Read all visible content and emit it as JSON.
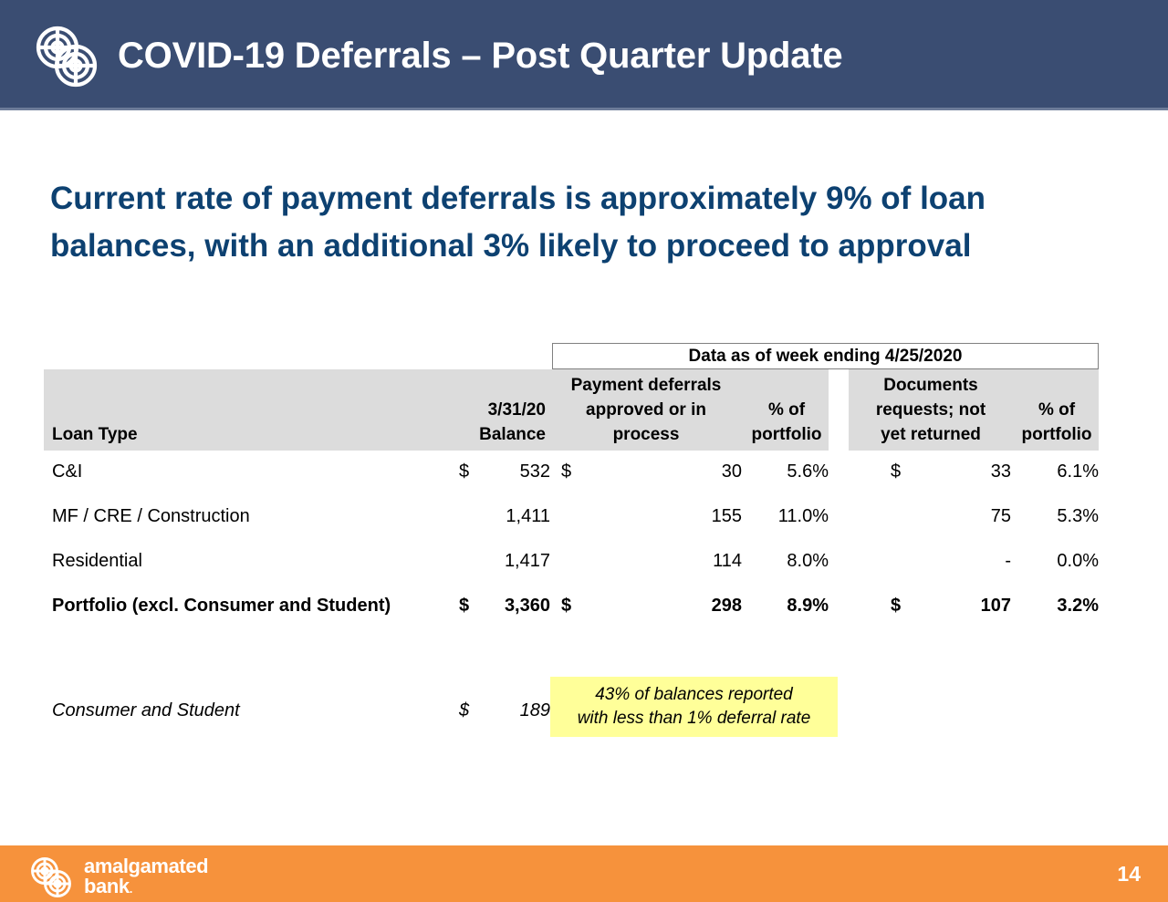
{
  "header": {
    "title": "COVID-19 Deferrals – Post Quarter Update",
    "logo_icon": "amalgamated-spiral-logo-icon",
    "bar_color": "#3a4d72"
  },
  "headline": {
    "line1": "Current rate of payment deferrals is approximately 9% of loan",
    "line2": "balances, with an additional 3% likely to proceed to approval",
    "color": "#0d4171"
  },
  "table": {
    "banner": "Data as of week ending 4/25/2020",
    "band_color": "#dcdcdc",
    "columns": {
      "loan_type": "Loan Type",
      "balance_l1": "3/31/20",
      "balance_l2": "Balance",
      "deferrals_l1": "Payment deferrals",
      "deferrals_l2": "approved or in",
      "deferrals_l3": "process",
      "pct1_l1": "% of",
      "pct1_l2": "portfolio",
      "docs_l1": "Documents",
      "docs_l2": "requests; not",
      "docs_l3": "yet returned",
      "pct2_l1": "% of",
      "pct2_l2": "portfolio"
    },
    "rows": [
      {
        "label": "C&I",
        "balance_currency": "$",
        "balance": "532",
        "deferrals_currency": "$",
        "deferrals": "30",
        "pct_portfolio_1": "5.6%",
        "docs_currency": "$",
        "docs": "33",
        "pct_portfolio_2": "6.1%"
      },
      {
        "label": "MF / CRE / Construction",
        "balance_currency": "",
        "balance": "1,411",
        "deferrals_currency": "",
        "deferrals": "155",
        "pct_portfolio_1": "11.0%",
        "docs_currency": "",
        "docs": "75",
        "pct_portfolio_2": "5.3%"
      },
      {
        "label": "Residential",
        "balance_currency": "",
        "balance": "1,417",
        "deferrals_currency": "",
        "deferrals": "114",
        "pct_portfolio_1": "8.0%",
        "docs_currency": "",
        "docs": "-",
        "pct_portfolio_2": "0.0%"
      },
      {
        "label": "Portfolio (excl. Consumer and Student)",
        "balance_currency": "$",
        "balance": "3,360",
        "deferrals_currency": "$",
        "deferrals": "298",
        "pct_portfolio_1": "8.9%",
        "docs_currency": "$",
        "docs": "107",
        "pct_portfolio_2": "3.2%"
      }
    ],
    "note_row": {
      "label": "Consumer and Student",
      "balance_currency": "$",
      "balance": "189",
      "highlight_line1": "43% of balances reported",
      "highlight_line2": "with less than 1% deferral rate",
      "highlight_color": "#ffff99"
    }
  },
  "footer": {
    "bar_color": "#f6923c",
    "logo_icon": "amalgamated-spiral-logo-icon",
    "wordmark_line1": "amalgamated",
    "wordmark_line2": "bank",
    "wordmark_dot": ".",
    "page_number": "14"
  }
}
